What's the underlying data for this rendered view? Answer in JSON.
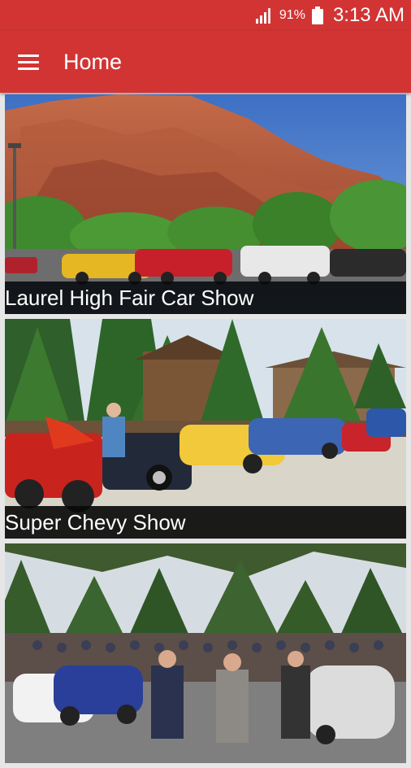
{
  "status_bar": {
    "battery_percent": "91%",
    "time": "3:13 AM",
    "icons": [
      "signal-icon",
      "battery-icon"
    ]
  },
  "app_bar": {
    "title": "Home",
    "menu_icon": "menu-icon",
    "background_color": "#d23434"
  },
  "cards": [
    {
      "title": "Laurel High Fair Car Show"
    },
    {
      "title": "Super Chevy Show"
    },
    {
      "title": ""
    }
  ]
}
